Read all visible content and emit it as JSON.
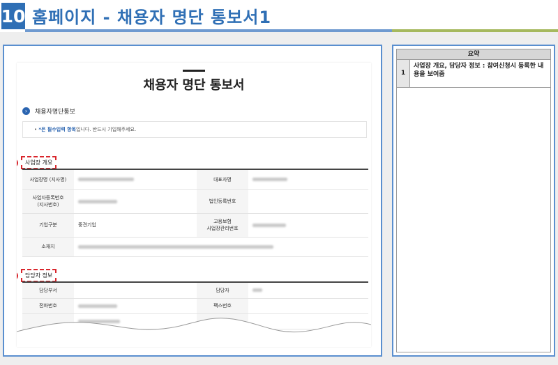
{
  "header": {
    "section_number": "10",
    "title": "홈페이지 - 채용자 명단 통보서1"
  },
  "document": {
    "title": "채용자 명단 통보서",
    "section_link": "채용자명단통보",
    "notice_prefix": "• ",
    "notice_required": "*은 필수입력 항목",
    "notice_suffix": "입니다. 반드시 기입해주세요.",
    "marker_label": "1",
    "section1": {
      "title": "사업장 개요",
      "rows": [
        {
          "label1": "사업장명 (지사명)",
          "value1": "",
          "label2": "대표자명",
          "value2": ""
        },
        {
          "label1": "사업자등록번호\n(지사번호)",
          "value1": "",
          "label2": "법인등록번호",
          "value2": ""
        },
        {
          "label1": "기업구분",
          "value1": "중견기업",
          "label2": "고용보험\n사업장관리번호",
          "value2": ""
        },
        {
          "label1": "소재지",
          "value1": "",
          "label2": "",
          "value2": ""
        }
      ]
    },
    "section2": {
      "title": "담당자 정보",
      "rows": [
        {
          "label1": "담당부서",
          "value1": "",
          "label2": "담당자",
          "value2": ""
        },
        {
          "label1": "전화번호",
          "value1": "",
          "label2": "팩스번호",
          "value2": ""
        },
        {
          "label1": "",
          "value1": "",
          "label2": "",
          "value2": ""
        }
      ]
    }
  },
  "summary": {
    "header": "요약",
    "items": [
      {
        "num": "1",
        "text": "사업장 개요, 담당자 정보 : 참여신청시 등록한 내용을 보여줌"
      }
    ]
  },
  "colors": {
    "accent_blue": "#2f6fb5",
    "marker_red": "#d9262c",
    "bar_green": "#a6b95e"
  }
}
